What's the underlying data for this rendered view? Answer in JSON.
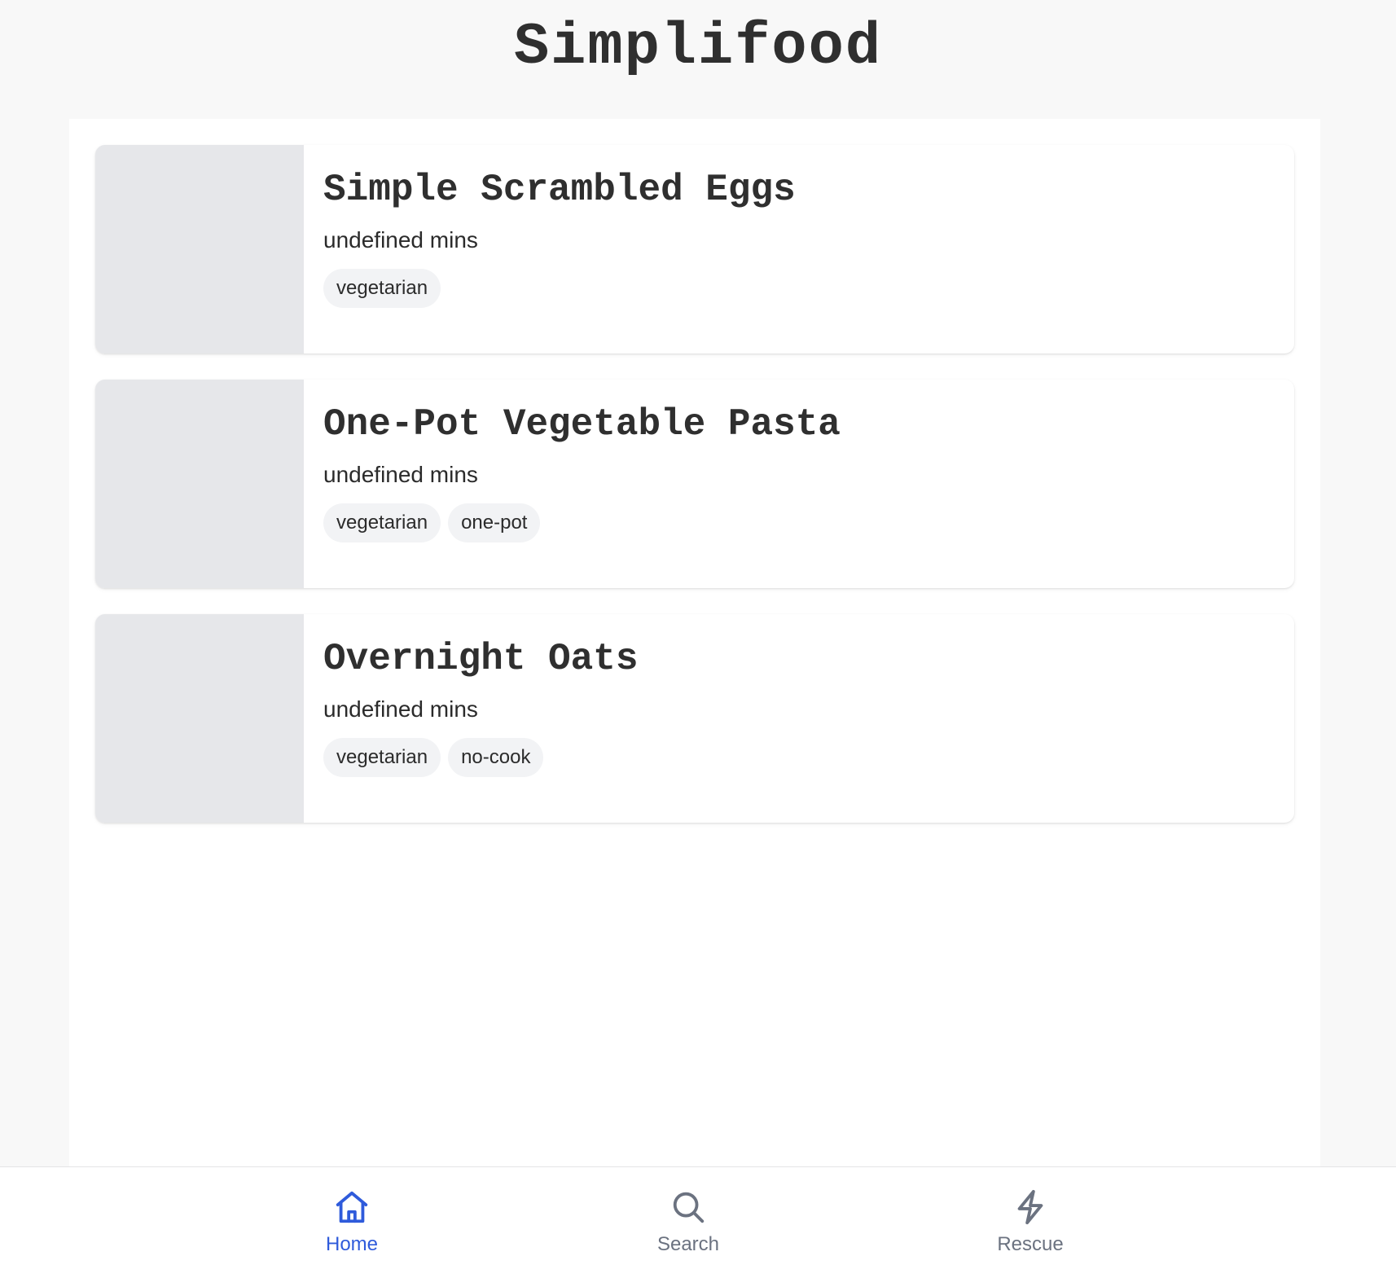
{
  "app": {
    "title": "Simplifood"
  },
  "recipes": [
    {
      "title": "Simple Scrambled Eggs",
      "time": "undefined mins",
      "tags": [
        "vegetarian"
      ]
    },
    {
      "title": "One-Pot Vegetable Pasta",
      "time": "undefined mins",
      "tags": [
        "vegetarian",
        "one-pot"
      ]
    },
    {
      "title": "Overnight Oats",
      "time": "undefined mins",
      "tags": [
        "vegetarian",
        "no-cook"
      ]
    }
  ],
  "nav": {
    "items": [
      {
        "label": "Home",
        "icon": "home-icon",
        "active": true
      },
      {
        "label": "Search",
        "icon": "search-icon",
        "active": false
      },
      {
        "label": "Rescue",
        "icon": "lightning-icon",
        "active": false
      }
    ]
  },
  "colors": {
    "accent": "#2f5bdb",
    "nav_inactive": "#6b7280",
    "placeholder": "#e6e7ea",
    "tag_bg": "#f2f3f5",
    "page_bg": "#f8f8f8"
  }
}
